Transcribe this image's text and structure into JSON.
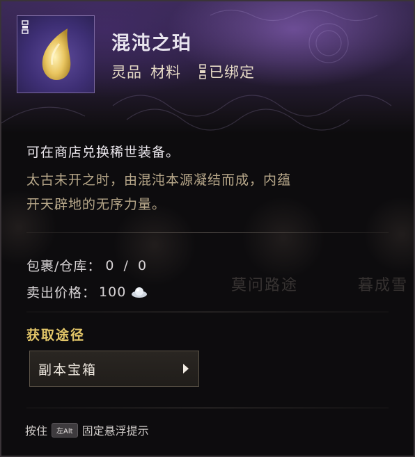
{
  "item": {
    "name": "混沌之珀",
    "quality": "灵品",
    "category": "材料",
    "bind_status": "已绑定",
    "icon": "amber-drop-icon"
  },
  "description": {
    "usage": "可在商店兑换稀世装备。",
    "lore_line1": "太古未开之时，由混沌本源凝结而成，内蕴",
    "lore_line2": "开天辟地的无序力量。"
  },
  "stats": {
    "inventory_label": "包裹/仓库：",
    "inventory_value": "0 / 0",
    "price_label": "卖出价格：",
    "price_value": "100",
    "currency_icon": "silver-ingot-icon"
  },
  "acquire": {
    "title": "获取途径",
    "sources": [
      {
        "label": "副本宝箱"
      }
    ]
  },
  "footer": {
    "prefix": "按住",
    "key": "左Alt",
    "suffix": "固定悬浮提示"
  },
  "background": {
    "labels": [
      "莫问路途",
      "暮成雪"
    ]
  },
  "colors": {
    "header_purple": "#3a2a55",
    "section_gold": "#e4c769",
    "lore_text": "#b8a88a"
  }
}
